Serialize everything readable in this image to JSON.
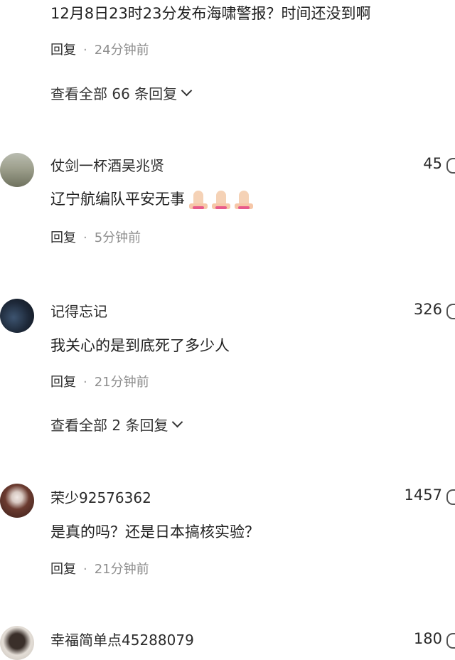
{
  "top_comment": {
    "text": "12月8日23时23分发布海啸警报？时间还没到啊",
    "reply_label": "回复",
    "time": "24分钟前"
  },
  "expand_1": {
    "label": "查看全部 66 条回复"
  },
  "comments": [
    {
      "username": "仗剑一杯酒吴兆贤",
      "likes": "45",
      "text": "辽宁航编队平安无事",
      "reply_label": "回复",
      "time": "5分钟前",
      "avatar_color": "#8a8f7a"
    },
    {
      "username": "记得忘记",
      "likes": "326",
      "text": "我关心的是到底死了多少人",
      "reply_label": "回复",
      "time": "21分钟前",
      "avatar_color": "#1d2838"
    },
    {
      "username": "荣少92576362",
      "likes": "1457",
      "text": "是真的吗？还是日本搞核实验？",
      "reply_label": "回复",
      "time": "21分钟前",
      "avatar_color": "#4a2a22"
    },
    {
      "username": "幸福简单点45288079",
      "likes": "180",
      "avatar_color": "#c9c3bb"
    }
  ],
  "expand_2": {
    "label": "查看全部 2 条回复"
  },
  "icons": {
    "like": "thumbs-up-icon",
    "chevron": "chevron-down-icon",
    "emoji": "folded-hands-emoji"
  }
}
